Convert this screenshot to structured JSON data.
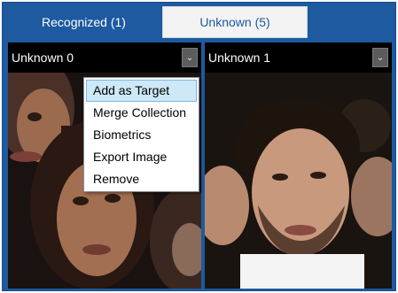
{
  "tabs": [
    {
      "label": "Recognized (1)",
      "active": true
    },
    {
      "label": "Unknown (5)",
      "active": false
    }
  ],
  "panels": [
    {
      "title": "Unknown 0",
      "dropdown_icon": "chevron-down-icon"
    },
    {
      "title": "Unknown 1",
      "dropdown_icon": "chevron-down-icon"
    }
  ],
  "context_menu": {
    "items": [
      {
        "label": "Add as Target",
        "highlighted": true
      },
      {
        "label": "Merge Collection"
      },
      {
        "label": "Biometrics"
      },
      {
        "label": "Export Image"
      },
      {
        "label": "Remove"
      }
    ]
  },
  "colors": {
    "accent": "#1d5aa0",
    "tab_inactive_bg": "#f3f3f3",
    "panel_bg": "#000000",
    "menu_highlight": "#cde8f6"
  }
}
